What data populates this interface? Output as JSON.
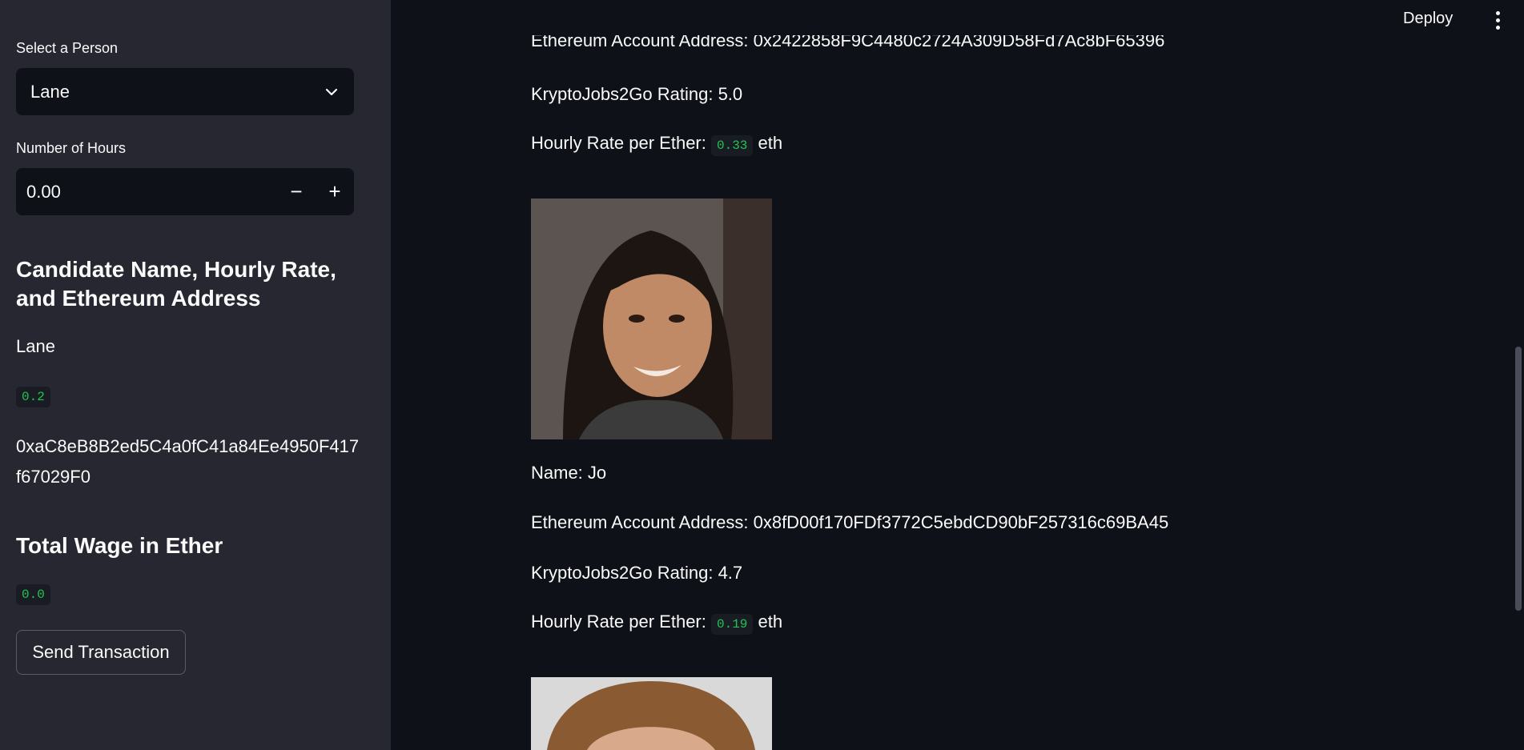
{
  "sidebar": {
    "select_label": "Select a Person",
    "select_value": "Lane",
    "hours_label": "Number of Hours",
    "hours_value": "0.00",
    "minus": "−",
    "plus": "+",
    "candidate_heading": "Candidate Name, Hourly Rate, and Ethereum Address",
    "candidate_name": "Lane",
    "candidate_rate": "0.2",
    "candidate_address": "0xaC8eB8B2ed5C4a0fC41a84Ee4950F417f67029F0",
    "wage_heading": "Total Wage in Ether",
    "wage_value": "0.0",
    "send_button": "Send Transaction"
  },
  "topbar": {
    "deploy": "Deploy"
  },
  "main": {
    "partial_address": "Ethereum Account Address: 0x2422858F9C4480c2724A309D58Fd7Ac8bF65396",
    "card1": {
      "rating": "KryptoJobs2Go Rating: 5.0",
      "rate_prefix": "Hourly Rate per Ether:",
      "rate_value": "0.33",
      "rate_suffix": "eth"
    },
    "card2": {
      "name": "Name: Jo",
      "address": "Ethereum Account Address: 0x8fD00f170FDf3772C5ebdCD90bF257316c69BA45",
      "rating": "KryptoJobs2Go Rating: 4.7",
      "rate_prefix": "Hourly Rate per Ether:",
      "rate_value": "0.19",
      "rate_suffix": "eth"
    }
  },
  "colors": {
    "accent_green": "#21c354",
    "sidebar_bg": "#262730",
    "main_bg": "#0e1117"
  }
}
